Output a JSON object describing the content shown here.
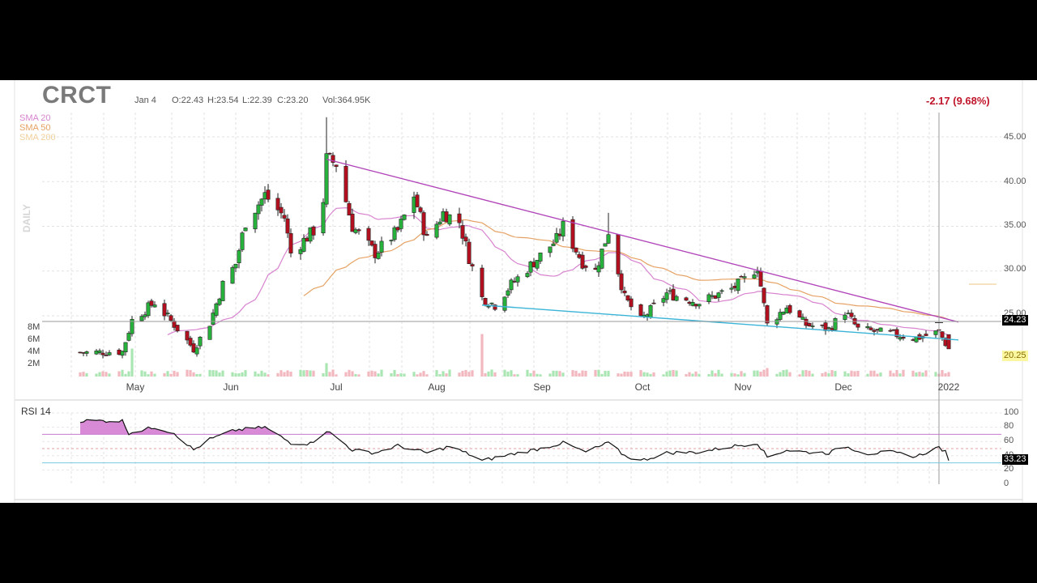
{
  "header": {
    "ticker": "CRCT",
    "date": "Jan 4",
    "open": "O:22.43",
    "high": "H:23.54",
    "low": "L:22.39",
    "close": "C:23.20",
    "volume": "Vol:364.95K",
    "change": "-2.17 (9.68%)",
    "timeframe": "DAILY"
  },
  "legend": [
    {
      "label": "SMA 20",
      "color": "#d883cf"
    },
    {
      "label": "SMA 50",
      "color": "#e6a264"
    },
    {
      "label": "SMA 200",
      "color": "#f0d09a"
    }
  ],
  "markers": {
    "last_price": "24.23",
    "current_price": "20.25",
    "rsi_value": "33.23"
  },
  "rsi_title": "RSI 14",
  "colors": {
    "up": "#27b23c",
    "down": "#b3101f",
    "upper_trendline": "#b044b8",
    "lower_trendline": "#3bb4d8",
    "rsi_line": "#111111",
    "rsi_fill": "#d98ad6"
  },
  "chart_data": [
    {
      "type": "candlestick",
      "title": "CRCT",
      "price_axis": {
        "ticks": [
          "45.00",
          "40.00",
          "35.00",
          "30.00",
          "25.00"
        ],
        "range": [
          19,
          46.5
        ]
      },
      "volume_axis": {
        "ticks": [
          "8M",
          "6M",
          "4M",
          "2M"
        ]
      },
      "x_tick_labels": [
        "May",
        "Jun",
        "Jul",
        "Aug",
        "Sep",
        "Oct",
        "Nov",
        "Dec",
        "2022"
      ],
      "price_anchors": [
        [
          "2021-04-16",
          20.9
        ],
        [
          "2021-04-27",
          21.0
        ],
        [
          "2021-04-30",
          24.5
        ],
        [
          "2021-05-07",
          26.5
        ],
        [
          "2021-05-13",
          24.0
        ],
        [
          "2021-05-19",
          21.3
        ],
        [
          "2021-05-24",
          24.2
        ],
        [
          "2021-05-28",
          28.5
        ],
        [
          "2021-06-01",
          30.8
        ],
        [
          "2021-06-04",
          35.5
        ],
        [
          "2021-06-10",
          38.5
        ],
        [
          "2021-06-16",
          36.0
        ],
        [
          "2021-06-18",
          32.0
        ],
        [
          "2021-06-25",
          34.5
        ],
        [
          "2021-06-28",
          38.0
        ],
        [
          "2021-06-29",
          42.5
        ],
        [
          "2021-07-02",
          42.0
        ],
        [
          "2021-07-07",
          35.0
        ],
        [
          "2021-07-14",
          32.0
        ],
        [
          "2021-07-21",
          34.5
        ],
        [
          "2021-07-26",
          38.5
        ],
        [
          "2021-07-30",
          33.5
        ],
        [
          "2021-08-04",
          36.5
        ],
        [
          "2021-08-09",
          35.5
        ],
        [
          "2021-08-12",
          31.5
        ],
        [
          "2021-08-16",
          27.0
        ],
        [
          "2021-08-20",
          26.2
        ],
        [
          "2021-08-25",
          28.5
        ],
        [
          "2021-09-01",
          31.0
        ],
        [
          "2021-09-08",
          33.5
        ],
        [
          "2021-09-10",
          35.0
        ],
        [
          "2021-09-16",
          31.0
        ],
        [
          "2021-09-20",
          30.0
        ],
        [
          "2021-09-24",
          34.5
        ],
        [
          "2021-09-29",
          27.0
        ],
        [
          "2021-10-04",
          24.5
        ],
        [
          "2021-10-12",
          27.5
        ],
        [
          "2021-10-22",
          26.5
        ],
        [
          "2021-11-01",
          28.0
        ],
        [
          "2021-11-05",
          29.0
        ],
        [
          "2021-11-09",
          30.5
        ],
        [
          "2021-11-12",
          24.0
        ],
        [
          "2021-11-18",
          26.0
        ],
        [
          "2021-11-24",
          24.0
        ],
        [
          "2021-12-01",
          23.5
        ],
        [
          "2021-12-06",
          25.5
        ],
        [
          "2021-12-10",
          23.5
        ],
        [
          "2021-12-20",
          23.0
        ],
        [
          "2021-12-28",
          22.5
        ],
        [
          "2022-01-04",
          23.2
        ],
        [
          "2022-01-07",
          21.3
        ]
      ],
      "volume_spikes": [
        [
          "2021-04-30",
          4.6
        ],
        [
          "2021-06-29",
          2.2
        ],
        [
          "2021-08-16",
          7.0
        ],
        [
          "2021-11-12",
          1.4
        ]
      ],
      "trendlines": [
        {
          "from": [
            "2021-06-29",
            42.5
          ],
          "to": [
            "2022-01-10",
            24.3
          ]
        },
        {
          "from": [
            "2021-08-16",
            26.2
          ],
          "to": [
            "2022-01-10",
            22.3
          ]
        }
      ]
    },
    {
      "type": "line",
      "title": "RSI 14",
      "y_ticks": [
        100,
        80,
        60,
        40,
        20,
        0
      ],
      "levels": [
        70,
        50,
        30
      ],
      "last_value": 33.23,
      "anchors": [
        [
          "2021-04-14",
          89
        ],
        [
          "2021-04-27",
          89
        ],
        [
          "2021-04-29",
          72
        ],
        [
          "2021-05-07",
          80
        ],
        [
          "2021-05-13",
          72
        ],
        [
          "2021-05-19",
          48
        ],
        [
          "2021-05-24",
          63
        ],
        [
          "2021-06-01",
          76
        ],
        [
          "2021-06-10",
          80
        ],
        [
          "2021-06-18",
          58
        ],
        [
          "2021-06-24",
          57
        ],
        [
          "2021-06-29",
          75
        ],
        [
          "2021-07-02",
          66
        ],
        [
          "2021-07-07",
          48
        ],
        [
          "2021-07-14",
          44
        ],
        [
          "2021-07-21",
          54
        ],
        [
          "2021-07-30",
          44
        ],
        [
          "2021-08-06",
          53
        ],
        [
          "2021-08-12",
          42
        ],
        [
          "2021-08-16",
          33
        ],
        [
          "2021-08-25",
          42
        ],
        [
          "2021-09-03",
          50
        ],
        [
          "2021-09-10",
          58
        ],
        [
          "2021-09-17",
          45
        ],
        [
          "2021-09-24",
          58
        ],
        [
          "2021-09-29",
          40
        ],
        [
          "2021-10-04",
          33
        ],
        [
          "2021-10-12",
          44
        ],
        [
          "2021-10-22",
          45
        ],
        [
          "2021-11-01",
          53
        ],
        [
          "2021-11-09",
          58
        ],
        [
          "2021-11-12",
          38
        ],
        [
          "2021-11-18",
          48
        ],
        [
          "2021-11-24",
          45
        ],
        [
          "2021-12-01",
          44
        ],
        [
          "2021-12-06",
          53
        ],
        [
          "2021-12-13",
          43
        ],
        [
          "2021-12-20",
          45
        ],
        [
          "2021-12-28",
          39
        ],
        [
          "2022-01-04",
          52
        ],
        [
          "2022-01-06",
          45
        ],
        [
          "2022-01-07",
          33.23
        ]
      ]
    }
  ]
}
